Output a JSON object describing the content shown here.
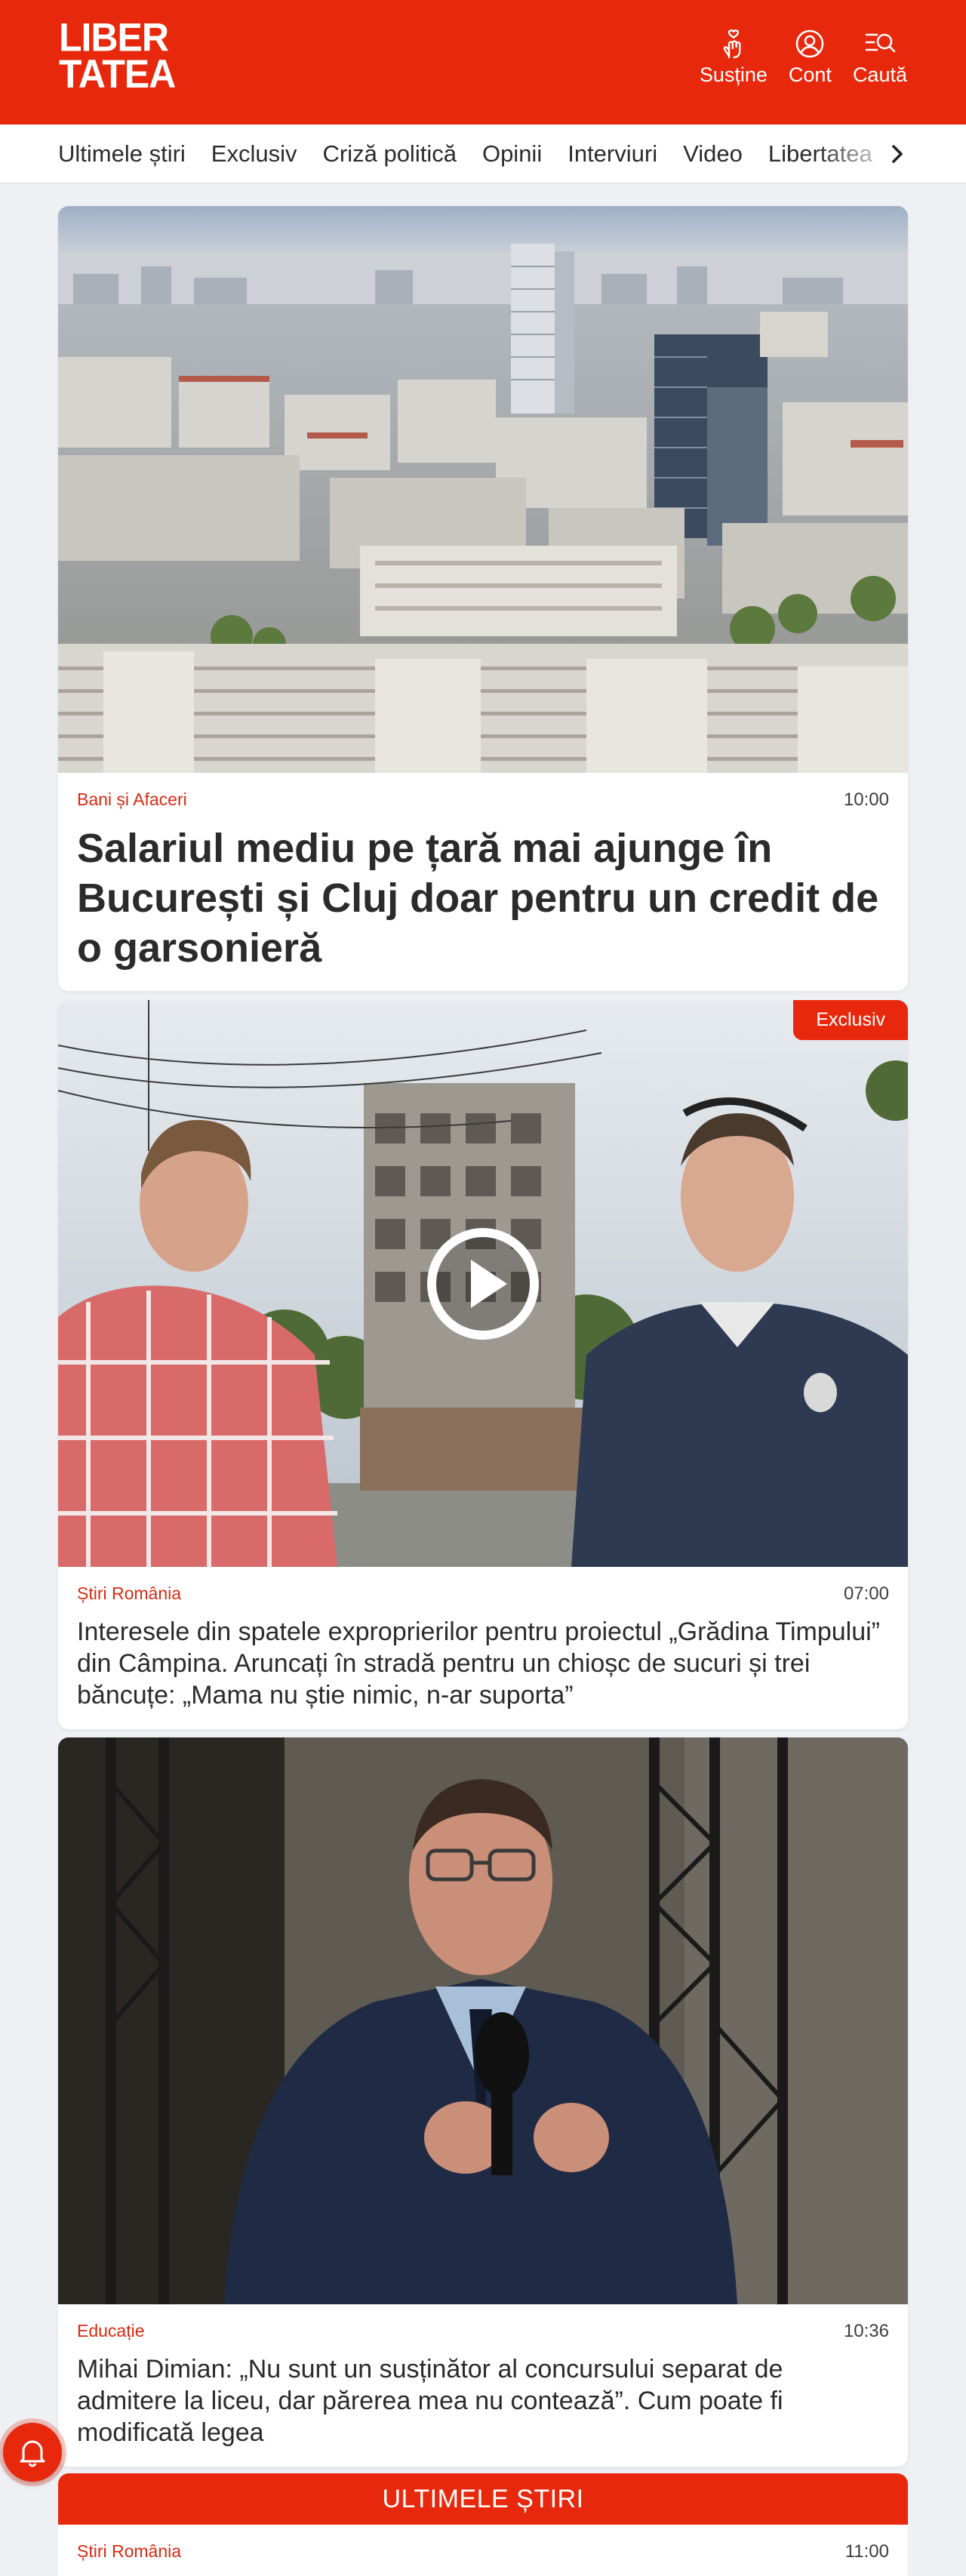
{
  "header": {
    "logo_line1": "LIBER",
    "logo_line2": "TATEA",
    "actions": [
      {
        "label": "Susține",
        "icon": "hand-heart-icon"
      },
      {
        "label": "Cont",
        "icon": "user-icon"
      },
      {
        "label": "Caută",
        "icon": "search-menu-icon"
      }
    ],
    "brand_color": "#e8280c"
  },
  "nav": {
    "items": [
      "Ultimele știri",
      "Exclusiv",
      "Criză politică",
      "Opinii",
      "Interviuri",
      "Video",
      "Libertatea"
    ],
    "arrow_icon": "chevron-right-icon"
  },
  "articles": [
    {
      "category": "Bani și Afaceri",
      "time": "10:00",
      "title": "Salariul mediu pe țară mai ajunge în București și Cluj doar pentru un credit de o garsonieră",
      "image": "city-aerial-photo"
    },
    {
      "category": "Știri România",
      "time": "07:00",
      "badge": "Exclusiv",
      "title": "Interesele din spatele exproprierilor pentru proiectul „Grădina Timpului” din Câmpina. Aruncați în stradă pentru un chioșc de sucuri și trei băncuțe: „Mama nu știe nimic, n-ar suporta”",
      "image": "video-thumbnail-two-men",
      "play_icon": "play-icon"
    },
    {
      "category": "Educație",
      "time": "10:36",
      "title": "Mihai Dimian: „Nu sunt un susținător al concursului separat de admitere la liceu, dar părerea mea nu contează”. Cum poate fi modificată legea",
      "image": "speaker-with-microphone-photo"
    }
  ],
  "latest": {
    "heading": "ULTIMELE ȘTIRI",
    "first": {
      "category": "Știri România",
      "time": "11:00"
    }
  },
  "notification": {
    "icon": "bell-icon"
  }
}
